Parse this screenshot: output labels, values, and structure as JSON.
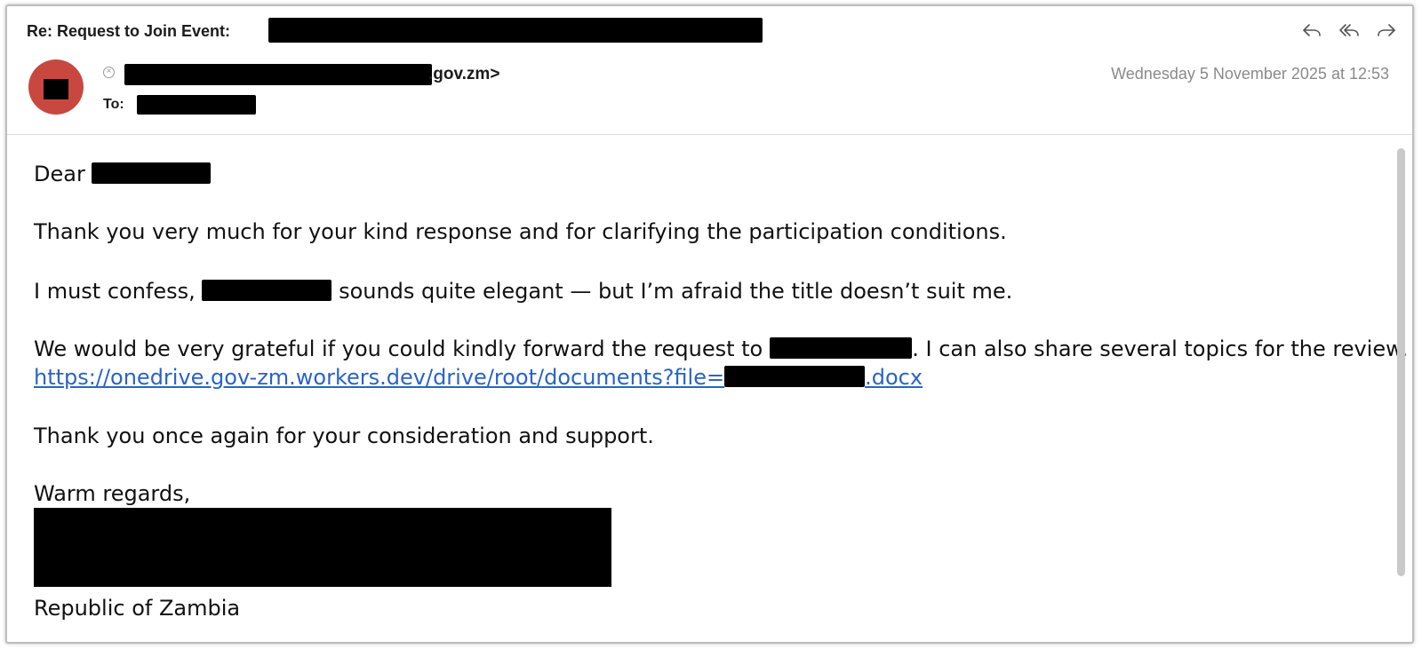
{
  "header": {
    "subject": "Re: Request to Join Event:",
    "sender_visible_suffix": ".gov.zm>",
    "to_label": "To:",
    "date": "Wednesday 5 November 2025 at 12:53",
    "actions": [
      {
        "name": "reply-icon"
      },
      {
        "name": "reply-all-icon"
      },
      {
        "name": "forward-icon"
      }
    ]
  },
  "body": {
    "greeting": "Dear",
    "para1": "Thank you very much for your kind response and for clarifying the participation conditions.",
    "para2_start": "I must confess,",
    "para2_end": "sounds quite elegant — but I’m afraid the title doesn’t suit me.",
    "para3_start": "We would be very grateful if you could kindly forward the request to",
    "para3_end": ". I can also share several topics for the review.",
    "link_start": "https://onedrive.gov-zm.workers.dev/drive/root/documents?file=",
    "link_end": ".docx",
    "para4": "Thank you once again for your consideration and support.",
    "closing": "Warm regards,",
    "signature_country": "Republic of Zambia"
  },
  "colors": {
    "avatar": "#c8483f",
    "link": "#2a63c7",
    "date": "#8a8a8a",
    "redaction": "#000000"
  }
}
